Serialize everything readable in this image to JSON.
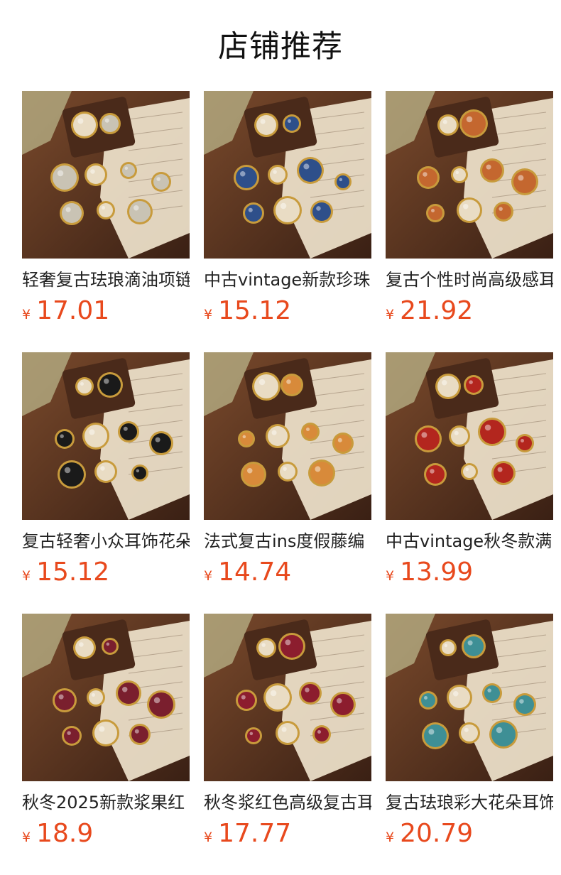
{
  "header": {
    "title": "店铺推荐"
  },
  "currency": "¥",
  "products": [
    {
      "name": "轻奢复古珐琅滴油项链",
      "price": "17.01",
      "accent": "#c9c3b4"
    },
    {
      "name": "中古vintage新款珍珠",
      "price": "15.12",
      "accent": "#2e4f8a"
    },
    {
      "name": "复古个性时尚高级感耳",
      "price": "21.92",
      "accent": "#c4672f"
    },
    {
      "name": "复古轻奢小众耳饰花朵",
      "price": "15.12",
      "accent": "#1a1a1a"
    },
    {
      "name": "法式复古ins度假藤编",
      "price": "14.74",
      "accent": "#d88a3a"
    },
    {
      "name": "中古vintage秋冬款满",
      "price": "13.99",
      "accent": "#b3261e"
    },
    {
      "name": "秋冬2025新款浆果红",
      "price": "18.9",
      "accent": "#7a1f2e"
    },
    {
      "name": "秋冬浆红色高级复古耳",
      "price": "17.77",
      "accent": "#8c1d2e"
    },
    {
      "name": "复古珐琅彩大花朵耳饰",
      "price": "20.79",
      "accent": "#3e8f95"
    }
  ]
}
